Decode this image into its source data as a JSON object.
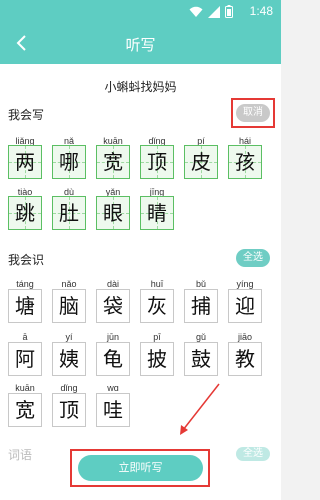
{
  "status": {
    "time": "1:48"
  },
  "header": {
    "back_icon": "chevron-left-icon",
    "title": "听写"
  },
  "subtitle": "小蝌蚪找妈妈",
  "write_section": {
    "title": "我会写",
    "cancel_label": "取消",
    "rows": [
      [
        {
          "py": "liǎng",
          "ch": "两"
        },
        {
          "py": "nǎ",
          "ch": "哪"
        },
        {
          "py": "kuān",
          "ch": "宽"
        },
        {
          "py": "dǐng",
          "ch": "顶"
        },
        {
          "py": "pí",
          "ch": "皮"
        },
        {
          "py": "hái",
          "ch": "孩"
        }
      ],
      [
        {
          "py": "tiào",
          "ch": "跳"
        },
        {
          "py": "dù",
          "ch": "肚"
        },
        {
          "py": "yǎn",
          "ch": "眼"
        },
        {
          "py": "jīng",
          "ch": "睛"
        }
      ]
    ]
  },
  "recognize_section": {
    "title": "我会识",
    "select_all_label": "全选",
    "rows": [
      [
        {
          "py": "táng",
          "ch": "塘"
        },
        {
          "py": "nǎo",
          "ch": "脑"
        },
        {
          "py": "dài",
          "ch": "袋"
        },
        {
          "py": "huī",
          "ch": "灰"
        },
        {
          "py": "bǔ",
          "ch": "捕"
        },
        {
          "py": "yíng",
          "ch": "迎"
        }
      ],
      [
        {
          "py": "ā",
          "ch": "阿"
        },
        {
          "py": "yí",
          "ch": "姨"
        },
        {
          "py": "jūn",
          "ch": "龟"
        },
        {
          "py": "pī",
          "ch": "披"
        },
        {
          "py": "gǔ",
          "ch": "鼓"
        },
        {
          "py": "jiāo",
          "ch": "教"
        }
      ],
      [
        {
          "py": "kuān",
          "ch": "宽"
        },
        {
          "py": "dǐng",
          "ch": "顶"
        },
        {
          "py": "wɑ",
          "ch": "哇"
        }
      ]
    ]
  },
  "phrase_section": {
    "title": "词语",
    "select_all_label": "全选"
  },
  "start_button_label": "立即听写",
  "colors": {
    "accent": "#5ecdc2",
    "highlight": "#e53935",
    "grid_green": "#5bbf63"
  }
}
